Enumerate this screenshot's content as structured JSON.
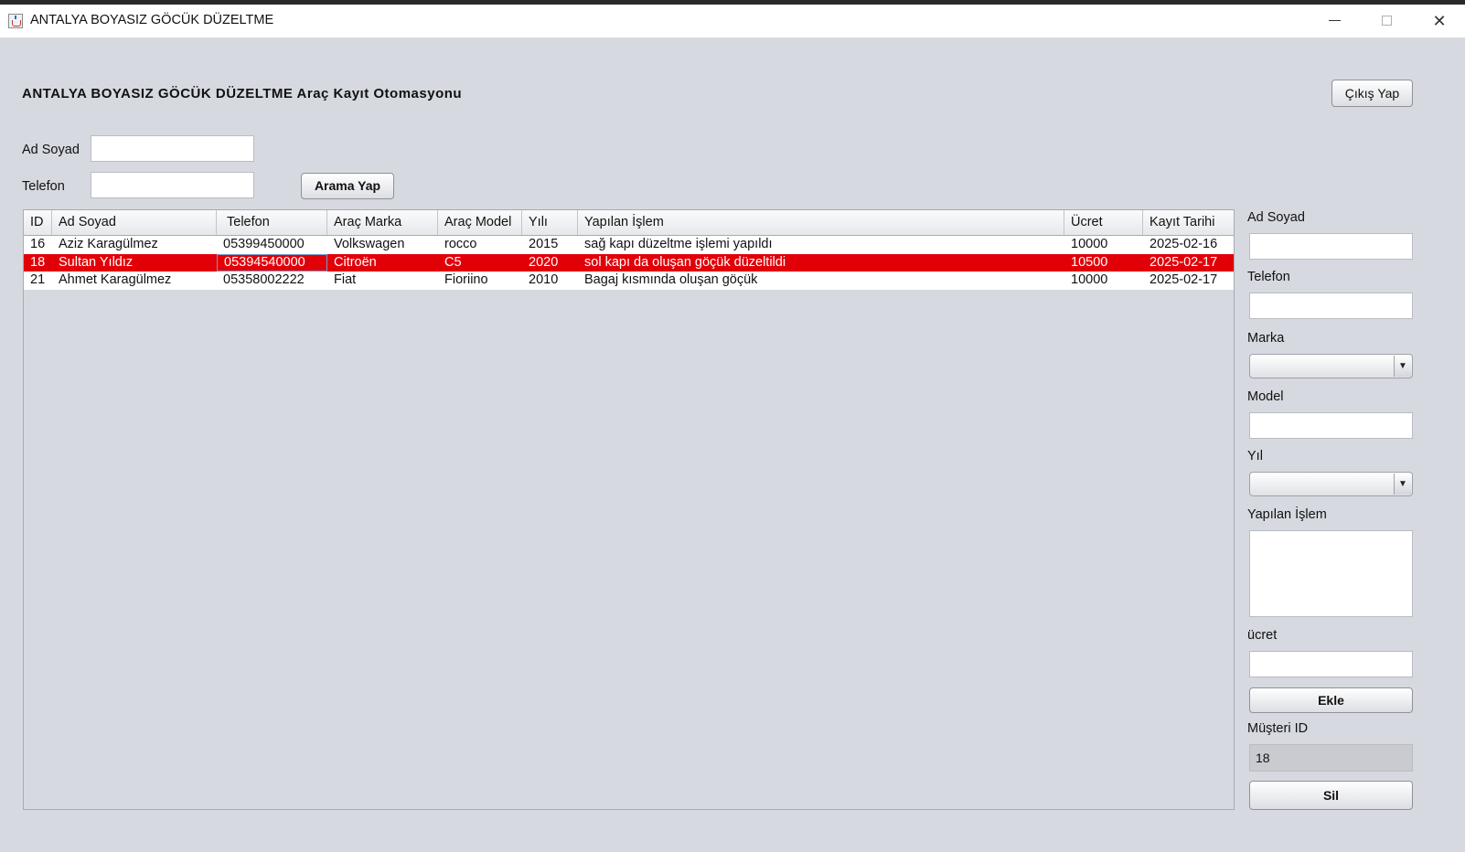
{
  "window": {
    "title": "ANTALYA BOYASIZ GÖCÜK DÜZELTME",
    "minimize": "–",
    "maximize": "□",
    "close": "✕"
  },
  "heading": "ANTALYA BOYASIZ GÖCÜK DÜZELTME Araç Kayıt Otomasyonu",
  "logout_label": "Çıkış Yap",
  "search": {
    "name_label": "Ad Soyad",
    "name_value": "",
    "phone_label": "Telefon",
    "phone_value": "",
    "button_label": "Arama Yap"
  },
  "table": {
    "columns": [
      "ID",
      "Ad Soyad",
      "Telefon",
      "Araç Marka",
      "Araç Model",
      "Yılı",
      "Yapılan İşlem",
      "Ücret",
      "Kayıt Tarihi"
    ],
    "rows": [
      [
        "16",
        "Aziz Karagülmez",
        "05399450000",
        "Volkswagen",
        "rocco",
        "2015",
        "sağ kapı düzeltme işlemi yapıldı",
        "10000",
        "2025-02-16"
      ],
      [
        "18",
        "Sultan Yıldız",
        "05394540000",
        "Citroën",
        "C5",
        "2020",
        "sol kapı da oluşan göçük  düzeltildi",
        "10500",
        "2025-02-17"
      ],
      [
        "21",
        "Ahmet Karagülmez",
        "05358002222",
        "Fiat",
        "Fioriino",
        "2010",
        "Bagaj kısmında oluşan göçük",
        "10000",
        "2025-02-17"
      ]
    ],
    "selected_row": 1,
    "selection_color": "#e20008"
  },
  "form": {
    "name_label": "Ad Soyad",
    "name_value": "",
    "phone_label": "Telefon",
    "phone_value": "",
    "brand_label": "Marka",
    "brand_selected": "",
    "model_label": "Model",
    "model_value": "",
    "year_label": "Yıl",
    "year_selected": "",
    "operation_label": "Yapılan İşlem",
    "operation_value": "",
    "fee_label": "ücret",
    "fee_value": "",
    "add_label": "Ekle",
    "customer_id_label": "Müşteri ID",
    "customer_id_value": "18",
    "delete_label": "Sil"
  },
  "icons": {
    "app": "java-cup-icon",
    "dropdown": "chevron-down-icon"
  }
}
